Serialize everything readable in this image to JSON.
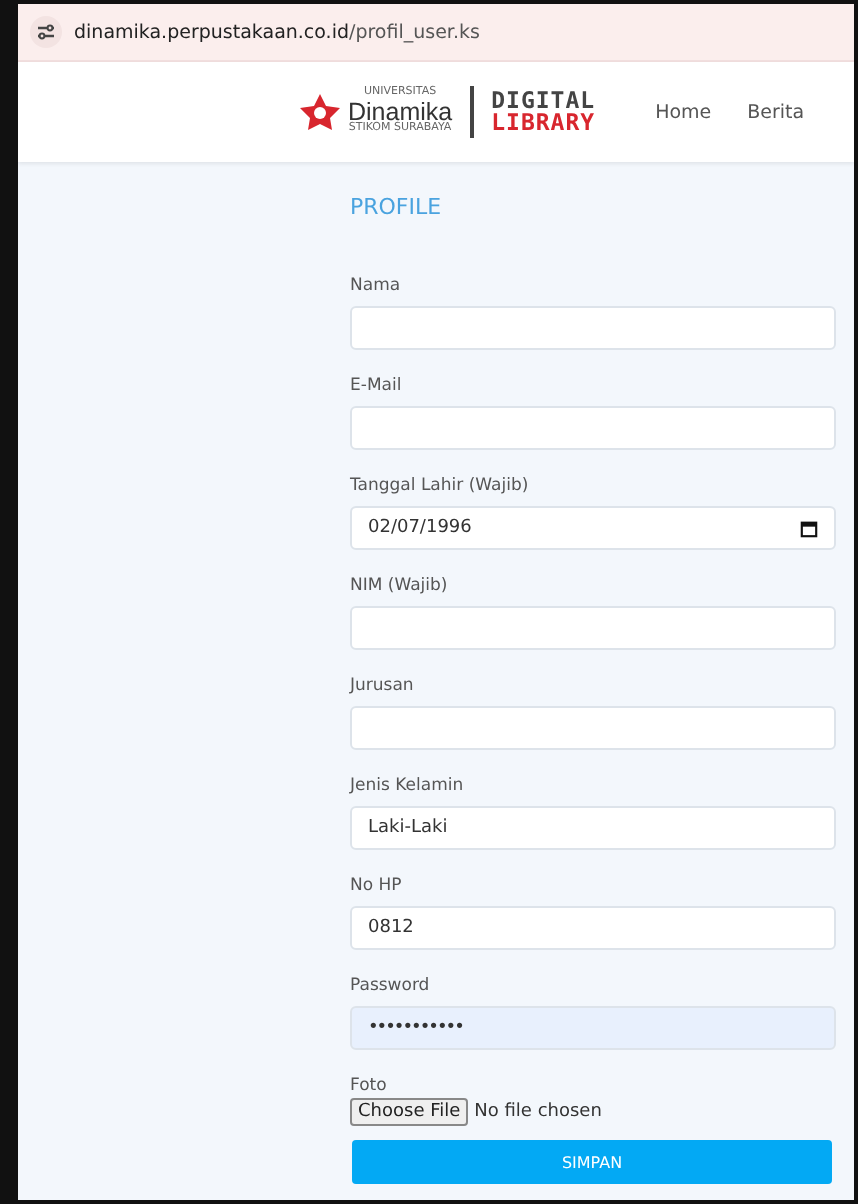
{
  "address_bar": {
    "url_host": "dinamika.perpustakaan.co.id",
    "url_path": "/profil_user.ks"
  },
  "header": {
    "logo": {
      "top": "UNIVERSITAS",
      "name": "Dinamika",
      "sub": "STIKOM SURABAYA",
      "line1": "DIGITAL",
      "line2": "LIBRARY"
    },
    "nav": [
      "Home",
      "Berita"
    ]
  },
  "form": {
    "title": "PROFILE",
    "fields": [
      {
        "label": "Nama",
        "kind": "text"
      },
      {
        "label": "E-Mail",
        "kind": "text"
      },
      {
        "label": "Tanggal Lahir (Wajib)",
        "kind": "date",
        "value": "02/07/1996"
      },
      {
        "label": "NIM (Wajib)",
        "kind": "text"
      },
      {
        "label": "Jurusan",
        "kind": "text"
      },
      {
        "label": "Jenis Kelamin",
        "kind": "text",
        "value": "Laki-Laki"
      },
      {
        "label": "No HP",
        "kind": "text",
        "value": "0812"
      },
      {
        "label": "Password",
        "kind": "password",
        "value": "•••••••••••"
      },
      {
        "label": "Foto",
        "kind": "file",
        "button": "Choose File",
        "status": "No file chosen"
      }
    ],
    "submit": "SIMPAN"
  }
}
